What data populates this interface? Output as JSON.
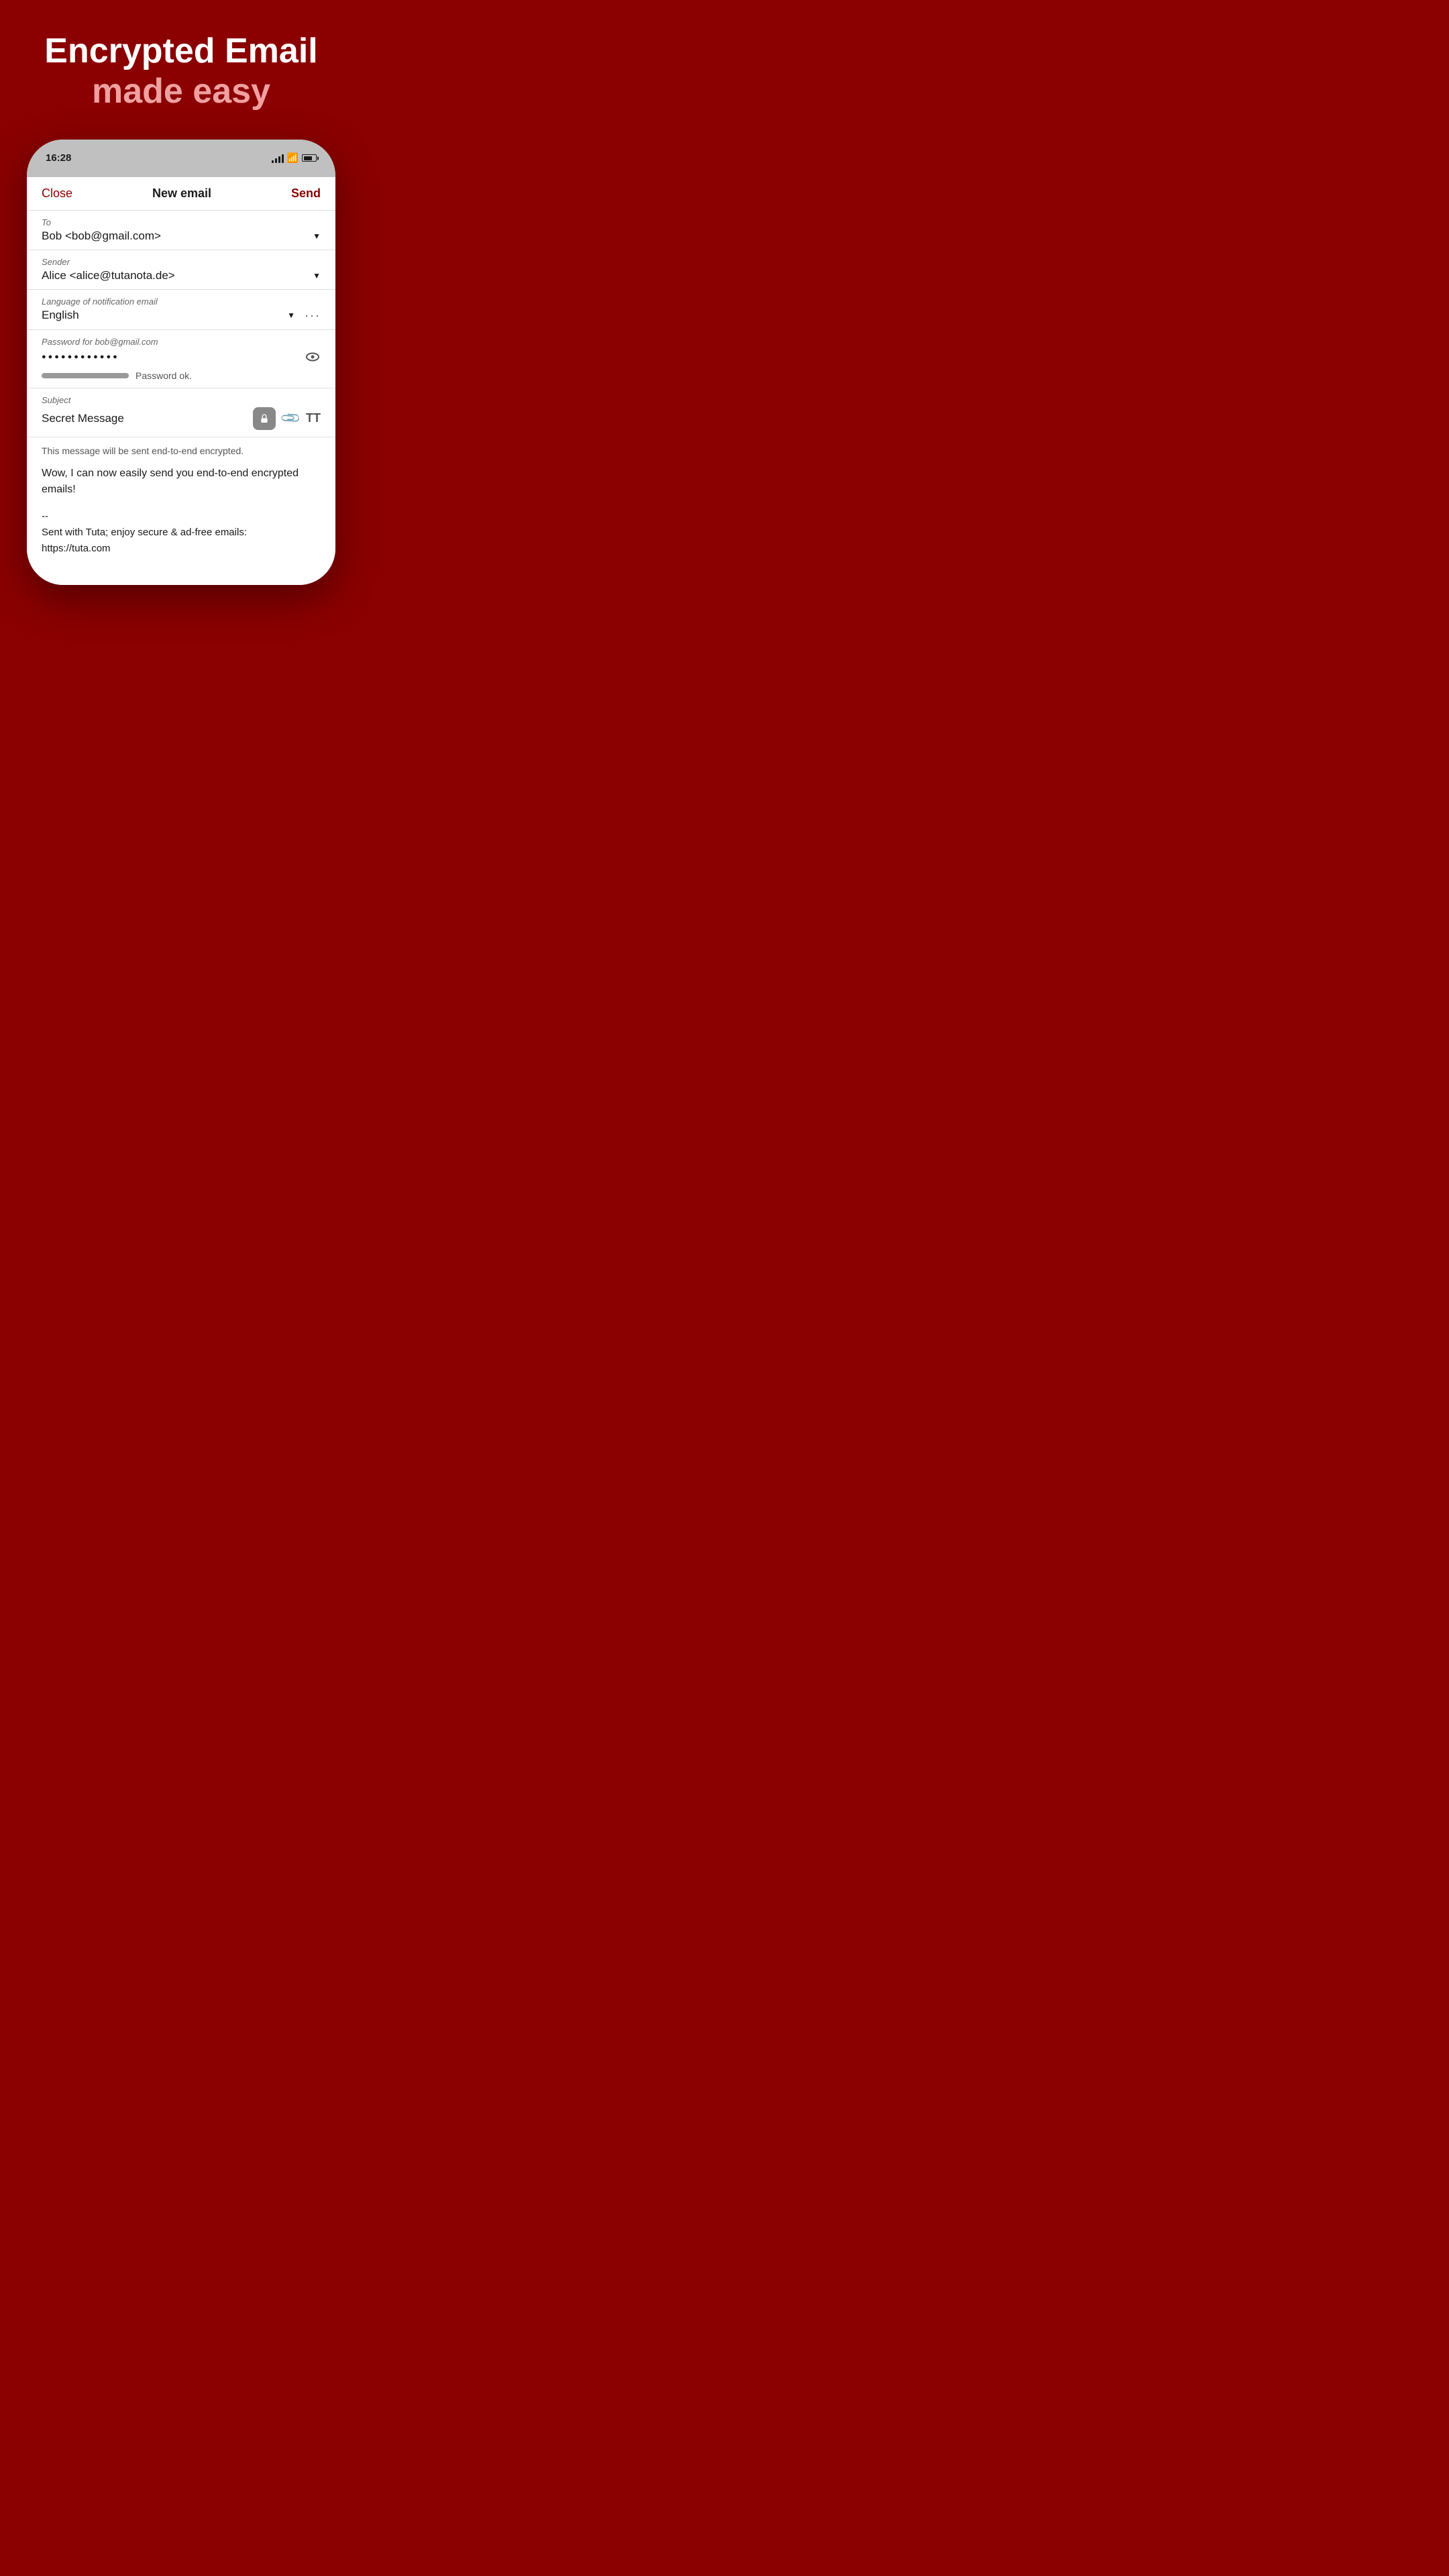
{
  "hero": {
    "line1": "Encrypted Email",
    "line2": "made easy"
  },
  "phone": {
    "status": {
      "time": "16:28"
    },
    "toolbar": {
      "close_label": "Close",
      "title_label": "New email",
      "send_label": "Send"
    },
    "to_field": {
      "label": "To",
      "value": "Bob <bob@gmail.com>"
    },
    "sender_field": {
      "label": "Sender",
      "value": "Alice <alice@tutanota.de>"
    },
    "language_field": {
      "label": "Language of notification email",
      "value": "English"
    },
    "password_field": {
      "label": "Password for bob@gmail.com",
      "value": "●●●●●●●●●●●●",
      "strength_text": "Password ok."
    },
    "subject_field": {
      "label": "Subject",
      "value": "Secret Message"
    },
    "body": {
      "encrypt_notice": "This message will be sent end-to-end encrypted.",
      "main_text": "Wow, I can now easily send you end-to-end encrypted emails!",
      "signature_line1": "--",
      "signature_line2": "Sent with Tuta; enjoy secure & ad-free emails:",
      "signature_link": "https://tuta.com"
    }
  }
}
